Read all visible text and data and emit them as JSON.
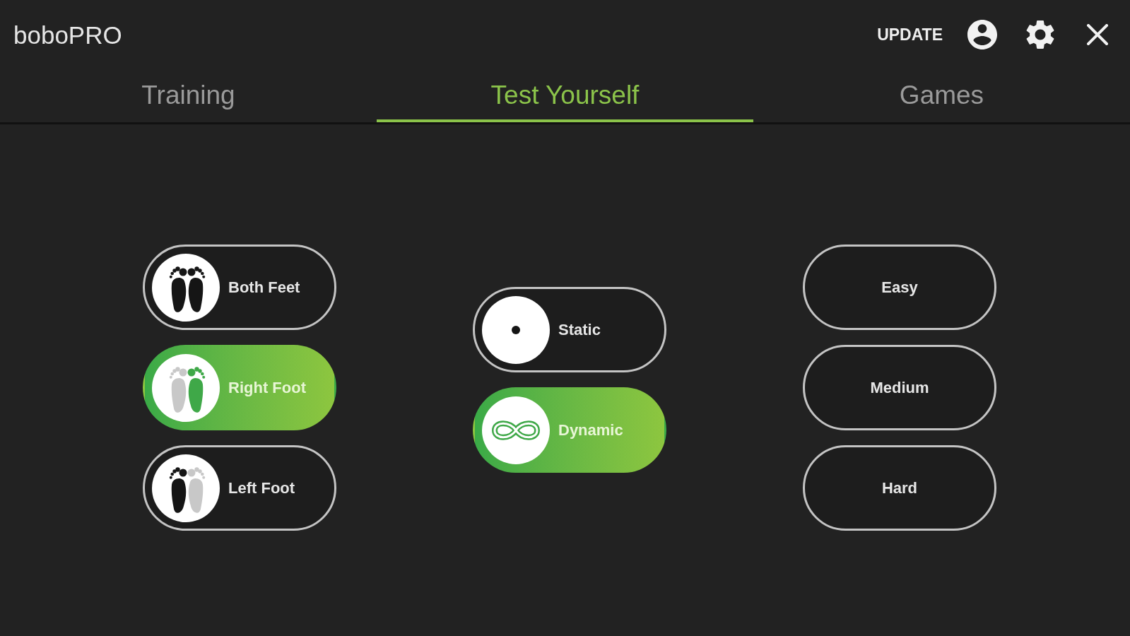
{
  "header": {
    "title": "boboPRO",
    "update_label": "UPDATE"
  },
  "tabs": [
    {
      "label": "Training",
      "selected": false
    },
    {
      "label": "Test Yourself",
      "selected": true
    },
    {
      "label": "Games",
      "selected": false
    }
  ],
  "foot_options": [
    {
      "kind": "both",
      "label": "Both Feet",
      "selected": false
    },
    {
      "kind": "right",
      "label": "Right Foot",
      "selected": true
    },
    {
      "kind": "left",
      "label": "Left Foot",
      "selected": false
    }
  ],
  "mode_options": [
    {
      "kind": "static",
      "label": "Static",
      "selected": false
    },
    {
      "kind": "dynamic",
      "label": "Dynamic",
      "selected": true
    }
  ],
  "difficulty_options": [
    {
      "label": "Easy",
      "selected": false
    },
    {
      "label": "Medium",
      "selected": false
    },
    {
      "label": "Hard",
      "selected": false
    }
  ]
}
